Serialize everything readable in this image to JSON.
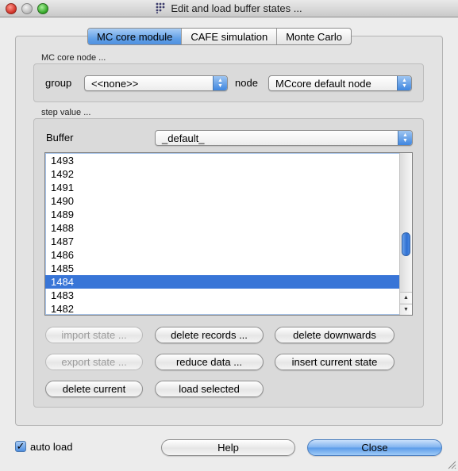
{
  "window": {
    "title": "Edit and load buffer states ..."
  },
  "tabs": [
    {
      "label": "MC core module",
      "active": true
    },
    {
      "label": "CAFE simulation",
      "active": false
    },
    {
      "label": "Monte Carlo",
      "active": false
    }
  ],
  "core_node": {
    "heading": "MC core node ...",
    "group_label": "group",
    "group_value": "<<none>>",
    "node_label": "node",
    "node_value": "MCcore default node"
  },
  "step_value": {
    "heading": "step value ...",
    "buffer_label": "Buffer",
    "buffer_value": "_default_",
    "items": [
      "1493",
      "1492",
      "1491",
      "1490",
      "1489",
      "1488",
      "1487",
      "1486",
      "1485",
      "1484",
      "1483",
      "1482"
    ],
    "selected": "1484"
  },
  "buttons": {
    "import_state": "import state ...",
    "delete_records": "delete records ...",
    "delete_downwards": "delete downwards",
    "export_state": "export state ...",
    "reduce_data": "reduce data ...",
    "insert_current_state": "insert current state",
    "delete_current": "delete current",
    "load_selected": "load selected"
  },
  "footer": {
    "auto_load_label": "auto load",
    "auto_load_checked": true,
    "help": "Help",
    "close": "Close"
  },
  "colors": {
    "selection": "#3875d7",
    "accent": "#5a9be9"
  }
}
